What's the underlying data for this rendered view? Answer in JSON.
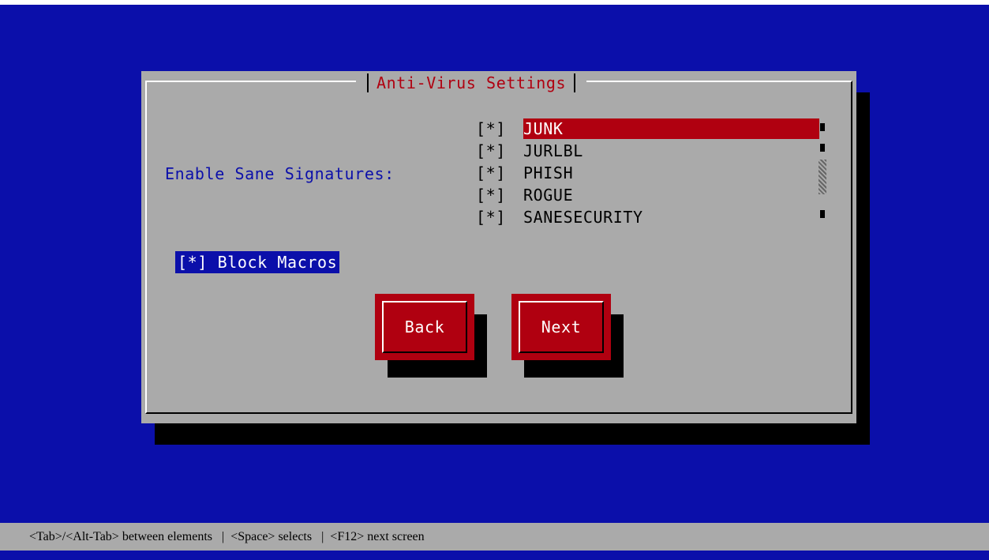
{
  "dialog": {
    "title": "Anti-Virus Settings"
  },
  "signatures": {
    "label": "Enable Sane Signatures:",
    "items": [
      {
        "checkbox": "[*]",
        "name": "JUNK",
        "selected": true
      },
      {
        "checkbox": "[*]",
        "name": "JURLBL",
        "selected": false
      },
      {
        "checkbox": "[*]",
        "name": "PHISH",
        "selected": false
      },
      {
        "checkbox": "[*]",
        "name": "ROGUE",
        "selected": false
      },
      {
        "checkbox": "[*]",
        "name": "SANESECURITY",
        "selected": false
      }
    ]
  },
  "block_macros": {
    "label": "[*] Block Macros",
    "checked": true
  },
  "buttons": {
    "back": "Back",
    "next": "Next"
  },
  "hint_bar": {
    "text": "<Tab>/<Alt-Tab> between elements   |  <Space> selects   |  <F12> next screen"
  },
  "colors": {
    "background": "#0b0faa",
    "dialog": "#aaaaaa",
    "accent": "#b00010",
    "selection": "#0b0faa"
  }
}
